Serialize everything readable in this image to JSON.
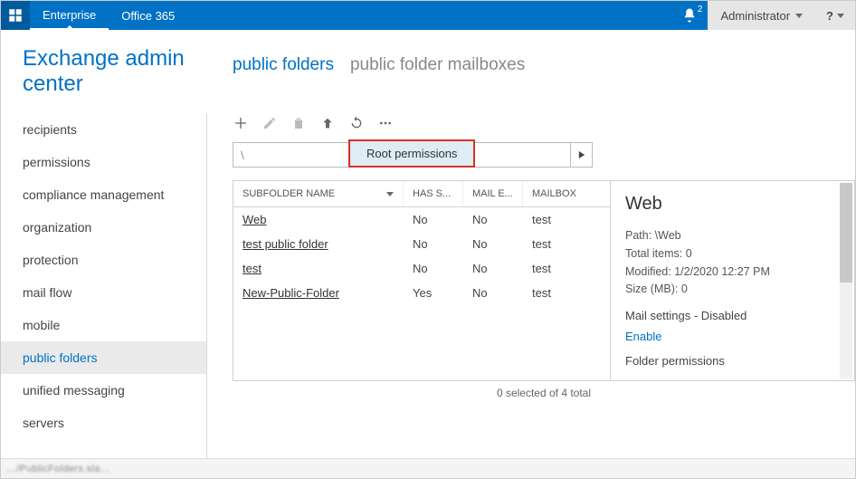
{
  "topbar": {
    "tabs": [
      "Enterprise",
      "Office 365"
    ],
    "notif_count": "2",
    "user": "Administrator",
    "help": "?"
  },
  "page_title": "Exchange admin center",
  "sidebar": {
    "items": [
      "recipients",
      "permissions",
      "compliance management",
      "organization",
      "protection",
      "mail flow",
      "mobile",
      "public folders",
      "unified messaging",
      "servers"
    ],
    "active": "public folders"
  },
  "tabs": {
    "items": [
      "public folders",
      "public folder mailboxes"
    ],
    "active": "public folders"
  },
  "path": "\\",
  "tooltip": "Root permissions",
  "grid": {
    "columns": [
      "SUBFOLDER NAME",
      "HAS S...",
      "MAIL E...",
      "MAILBOX"
    ],
    "rows": [
      {
        "name": "Web",
        "has": "No",
        "mail": "No",
        "mailbox": "test"
      },
      {
        "name": "test public folder",
        "has": "No",
        "mail": "No",
        "mailbox": "test"
      },
      {
        "name": "test",
        "has": "No",
        "mail": "No",
        "mailbox": "test"
      },
      {
        "name": "New-Public-Folder",
        "has": "Yes",
        "mail": "No",
        "mailbox": "test"
      }
    ],
    "footer": "0 selected of 4 total"
  },
  "details": {
    "title": "Web",
    "path_label": "Path:",
    "path": "\\Web",
    "items_label": "Total items:",
    "items": "0",
    "modified_label": "Modified:",
    "modified": "1/2/2020 12:27 PM",
    "size_label": "Size (MB):",
    "size": "0",
    "mail_settings": "Mail settings - Disabled",
    "enable": "Enable",
    "perms": "Folder permissions"
  },
  "statusbar": {
    "url": "…/PublicFolders.sla…"
  }
}
